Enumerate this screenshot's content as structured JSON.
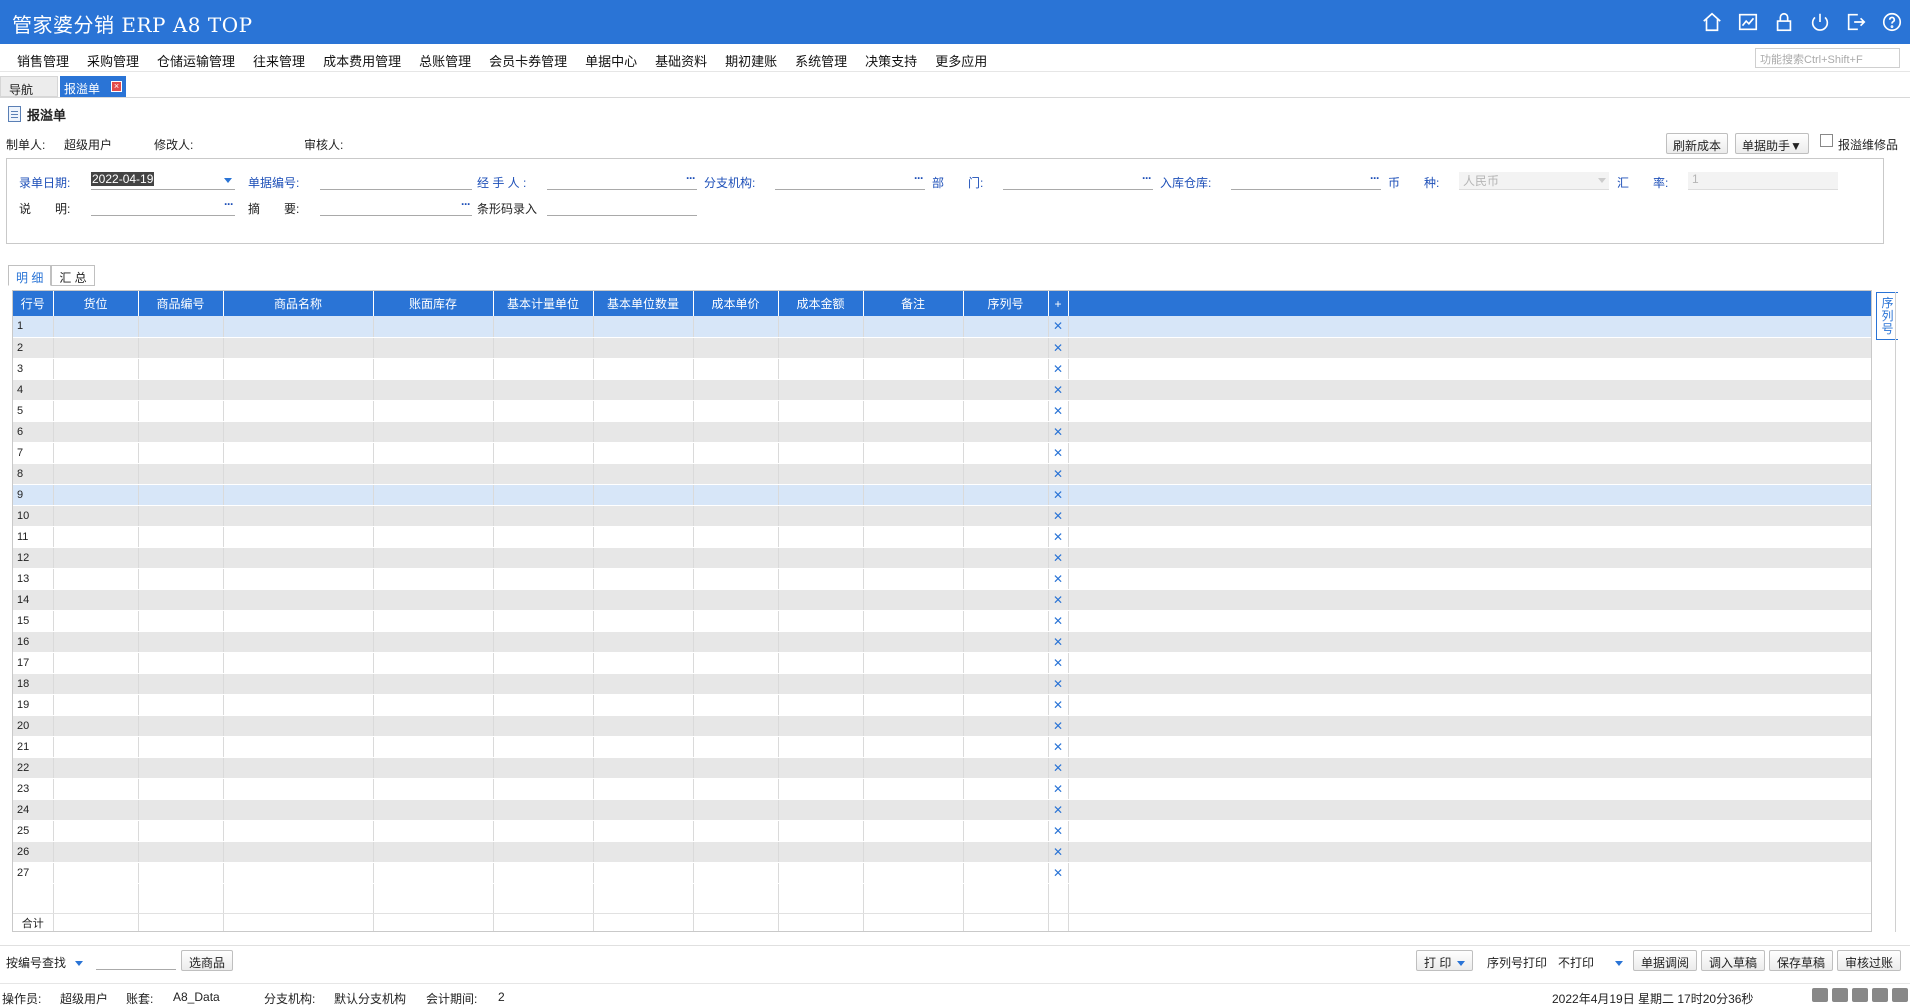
{
  "app": {
    "title": "管家婆分销 ERP A8 TOP",
    "colors": {
      "accent": "#2a74d6",
      "row_alt": "#e7e7e7",
      "row_highlight": "#d7e6f8"
    },
    "title_icons": [
      "home-icon",
      "chart-icon",
      "lock-icon",
      "power-icon",
      "logout-icon",
      "help-icon"
    ]
  },
  "menu": {
    "items": [
      "销售管理",
      "采购管理",
      "仓储运输管理",
      "往来管理",
      "成本费用管理",
      "总账管理",
      "会员卡券管理",
      "单据中心",
      "基础资料",
      "期初建账",
      "系统管理",
      "决策支持",
      "更多应用"
    ],
    "search_placeholder": "功能搜索Ctrl+Shift+F"
  },
  "tabs": {
    "nav": "导航",
    "active": "报溢单"
  },
  "doc": {
    "title": "报溢单",
    "creator_label": "制单人:",
    "creator_value": "超级用户",
    "modifier_label": "修改人:",
    "auditor_label": "审核人:",
    "refresh_cost": "刷新成本",
    "doc_helper": "单据助手▼",
    "repair_goods": "报溢维修品"
  },
  "form": {
    "date_label": "录单日期:",
    "date_value": "2022-04-19",
    "docno_label": "单据编号:",
    "handler_label": "经 手 人 :",
    "branch_label": "分支机构:",
    "dept_label": "部　　门:",
    "warehouse_label": "入库仓库:",
    "currency_label": "币　　种:",
    "currency_value": "人民币",
    "rate_label": "汇　　率:",
    "rate_value": "1",
    "note_label": "说　　明:",
    "summary_label": "摘　　要:",
    "barcode_label": "条形码录入"
  },
  "subtabs": [
    "明 细",
    "汇 总"
  ],
  "grid": {
    "columns": [
      "行号",
      "货位",
      "商品编号",
      "商品名称",
      "账面库存",
      "基本计量单位",
      "基本单位数量",
      "成本单价",
      "成本金额",
      "备注",
      "序列号",
      "+"
    ],
    "row_count": 27,
    "highlight_rows": [
      1,
      9
    ],
    "total_label": "合计"
  },
  "serial_tab": "序列号",
  "bottom": {
    "search_mode": "按编号查找",
    "select_goods": "选商品",
    "print": "打 印",
    "serial_print_label": "序列号打印",
    "serial_print_value": "不打印",
    "doc_adjust": "单据调阅",
    "load_draft": "调入草稿",
    "save_draft": "保存草稿",
    "audit_post": "审核过账"
  },
  "status": {
    "operator_label": "操作员:",
    "operator_value": "超级用户",
    "account_label": "账套:",
    "account_value": "A8_Data",
    "branch_label": "分支机构:",
    "branch_value": "默认分支机构",
    "period_label": "会计期间:",
    "period_value": "2",
    "datetime": "2022年4月19日  星期二  17时20分36秒"
  }
}
